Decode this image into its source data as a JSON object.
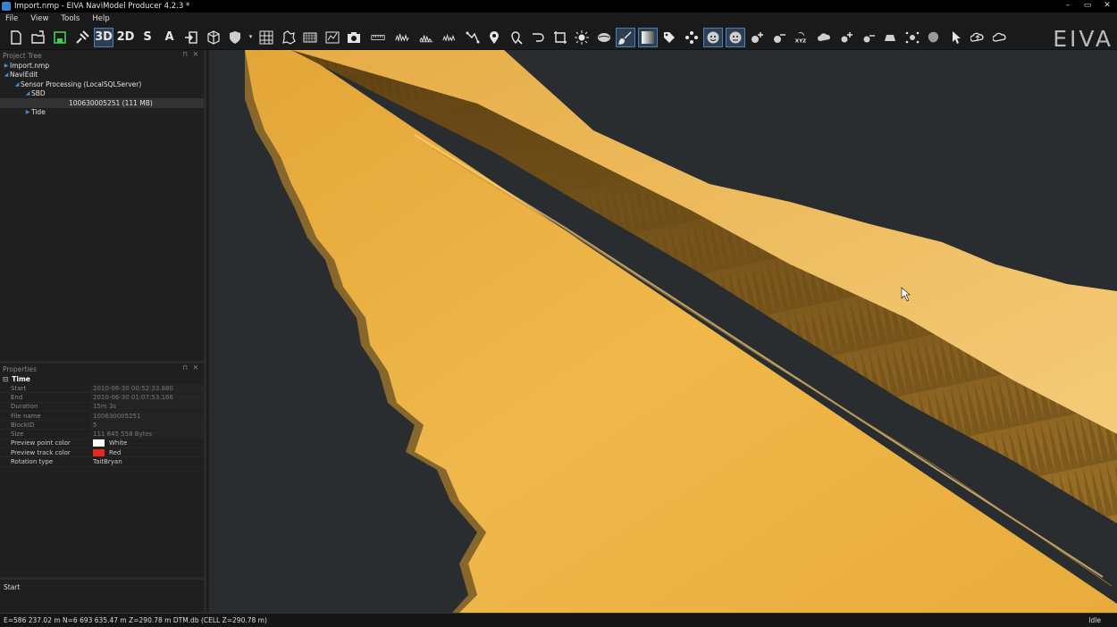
{
  "window": {
    "title": "Import.nmp - EIVA NaviModel Producer 4.2.3 *",
    "controls": [
      "–",
      "▭",
      "✕"
    ]
  },
  "menu": [
    "File",
    "View",
    "Tools",
    "Help"
  ],
  "toolbar": {
    "view_3d": "3D",
    "view_2d": "2D",
    "view_s": "S",
    "view_a": "A",
    "logo": "EIVA"
  },
  "project_tree": {
    "title": "Project Tree",
    "pin": "⊓",
    "close": "✕",
    "items": [
      {
        "label": "Import.nmp",
        "indent": 0,
        "arrow": "▶"
      },
      {
        "label": "NaviEdit",
        "indent": 0,
        "arrow": "◢"
      },
      {
        "label": "Sensor Processing (LocalSQLServer)",
        "indent": 1,
        "arrow": "◢"
      },
      {
        "label": "SBD",
        "indent": 2,
        "arrow": "◢"
      },
      {
        "label": "100630005251 (111 MB)",
        "indent": 3,
        "arrow": "",
        "selected": true
      },
      {
        "label": "Tide",
        "indent": 2,
        "arrow": "▶"
      }
    ]
  },
  "properties": {
    "title": "Properties",
    "pin": "⊓",
    "close": "✕",
    "group": "Time",
    "rows": [
      {
        "key": "Start",
        "value": "2010-06-30 00:52:33.880",
        "enabled": false
      },
      {
        "key": "End",
        "value": "2010-06-30 01:07:53.166",
        "enabled": false
      },
      {
        "key": "Duration",
        "value": "15m 3s",
        "enabled": false
      },
      {
        "key": "File name",
        "value": "100630005251",
        "enabled": false
      },
      {
        "key": "BlockID",
        "value": "5",
        "enabled": false
      },
      {
        "key": "Size",
        "value": "111 845 558 Bytes",
        "enabled": false
      },
      {
        "key": "Preview point color",
        "value": "White",
        "enabled": true,
        "swatch": "#ffffff"
      },
      {
        "key": "Preview track color",
        "value": "Red",
        "enabled": true,
        "swatch": "#e8281e"
      },
      {
        "key": "Rotation type",
        "value": "TaitBryan",
        "enabled": true
      }
    ]
  },
  "description": {
    "text": "Start"
  },
  "status": {
    "coords": "E=586 237.02 m N=6 693 635.47 m Z=290.78 m DTM.db (CELL Z=290.78 m)",
    "state": "Idle"
  },
  "colors": {
    "seabed": "#e8ad3d",
    "seabed_light": "#f0c060",
    "pipeline_wall": "#7d5a1e",
    "background": "#2a2d30"
  }
}
